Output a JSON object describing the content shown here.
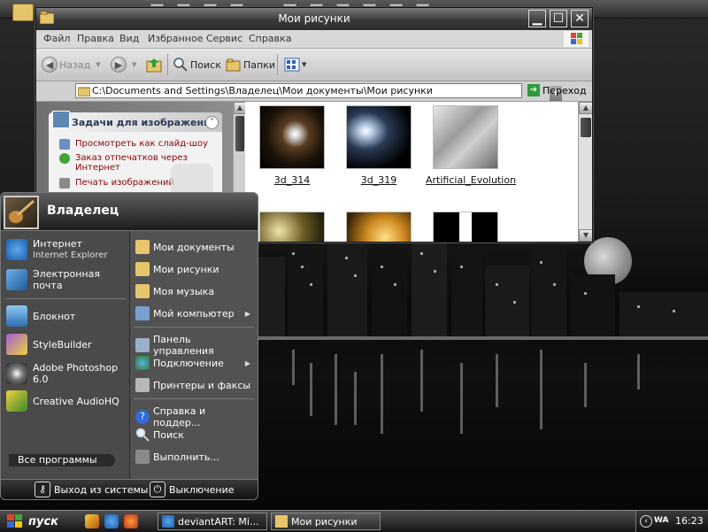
{
  "window": {
    "title": "Мои рисунки",
    "menu": [
      "Файл",
      "Правка",
      "Вид",
      "Избранное",
      "Сервис",
      "Справка"
    ],
    "toolbar": {
      "back": "Назад",
      "search": "Поиск",
      "folders": "Папки"
    },
    "address": {
      "path": "C:\\Documents and Settings\\Владелец\\Мои документы\\Мои рисунки",
      "go": "Переход"
    },
    "task_pane": {
      "title": "Задачи для изображений",
      "links": [
        "Просмотреть как слайд-шоу",
        "Заказ отпечатков через Интернет",
        "Печать изображений"
      ]
    },
    "files": [
      {
        "name": "3d_314"
      },
      {
        "name": "3d_319"
      },
      {
        "name": "Artificial_Evolution"
      },
      {
        "name": ""
      },
      {
        "name": ""
      },
      {
        "name": ""
      }
    ]
  },
  "start_menu": {
    "user": "Владелец",
    "pinned": [
      {
        "label": "Интернет",
        "sub": "Internet Explorer"
      },
      {
        "label": "Электронная почта",
        "sub": ""
      }
    ],
    "recent": [
      {
        "label": "Блокнот"
      },
      {
        "label": "StyleBuilder"
      },
      {
        "label": "Adobe Photoshop 6.0"
      },
      {
        "label": "Creative AudioHQ"
      }
    ],
    "all_programs": "Все программы",
    "places": [
      {
        "label": "Мои документы"
      },
      {
        "label": "Мои рисунки"
      },
      {
        "label": "Моя музыка"
      },
      {
        "label": "Мой компьютер"
      },
      {
        "label": "Панель управления"
      },
      {
        "label": "Подключение"
      },
      {
        "label": "Принтеры и факсы"
      },
      {
        "label": "Справка и поддер..."
      },
      {
        "label": "Поиск"
      },
      {
        "label": "Выполнить..."
      }
    ],
    "logoff": "Выход из системы",
    "shutdown": "Выключение"
  },
  "taskbar": {
    "start": "пуск",
    "tasks": [
      {
        "label": "deviantART: Mi..."
      },
      {
        "label": "Мои рисунки"
      }
    ],
    "tray_label": "WA",
    "clock": "16:23"
  },
  "colors": {
    "accent_dark": "#2c2c2c",
    "link_red": "#8b0000",
    "go_green": "#2f9a3b"
  }
}
